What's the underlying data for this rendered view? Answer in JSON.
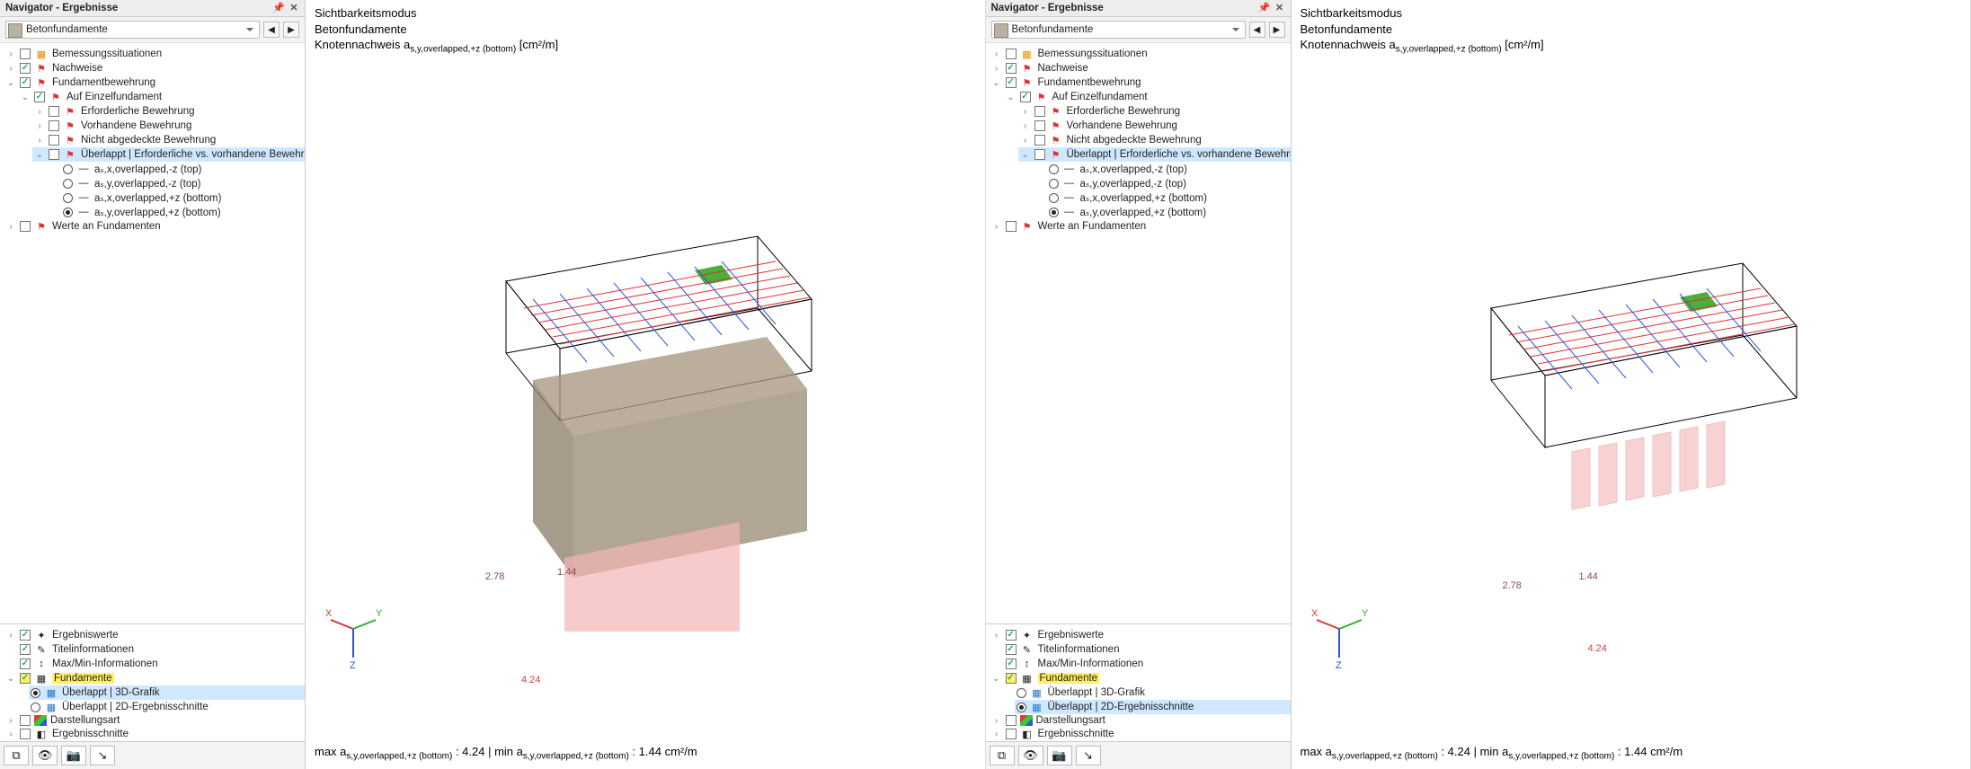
{
  "nav": {
    "title": "Navigator - Ergebnisse",
    "combo": "Betonfundamente",
    "tree_main": {
      "bemess": "Bemessungssituationen",
      "nachweise": "Nachweise",
      "fundbew": "Fundamentbewehrung",
      "aufeinzel": "Auf Einzelfundament",
      "erf": "Erforderliche Bewehrung",
      "vorh": "Vorhandene Bewehrung",
      "nicht": "Nicht abgedeckte Bewehrung",
      "uberl": "Überlappt | Erforderliche vs. vorhandene Bewehrung",
      "r1": "aₛ,x,overlapped,-z (top)",
      "r2": "aₛ,y,overlapped,-z (top)",
      "r3": "aₛ,x,overlapped,+z (bottom)",
      "r4": "aₛ,y,overlapped,+z (bottom)",
      "werte": "Werte an Fundamenten"
    },
    "tree_bottom": {
      "erg": "Ergebniswerte",
      "titel": "Titelinformationen",
      "maxmin": "Max/Min-Informationen",
      "fund": "Fundamente",
      "u3d": "Überlappt | 3D-Grafik",
      "u2d": "Überlappt | 2D-Ergebnisschnitte",
      "darst": "Darstellungsart",
      "schnitte": "Ergebnisschnitte"
    }
  },
  "header": {
    "line1": "Sichtbarkeitsmodus",
    "line2": "Betonfundamente",
    "line3_prefix": "Knotennachweis a",
    "line3_sub": "s,y,overlapped,+z (bottom)",
    "line3_unit": " [cm²/m]"
  },
  "footer": {
    "max_label": "max a",
    "min_label": "min a",
    "sub": "s,y,overlapped,+z (bottom)",
    "max_val": " : 4.24 | ",
    "min_val": " : 1.44 cm²/m"
  },
  "values": {
    "v1": "2.78",
    "v2": "1.44",
    "v3": "4.24"
  },
  "axes": {
    "x": "X",
    "y": "Y",
    "z": "Z"
  }
}
